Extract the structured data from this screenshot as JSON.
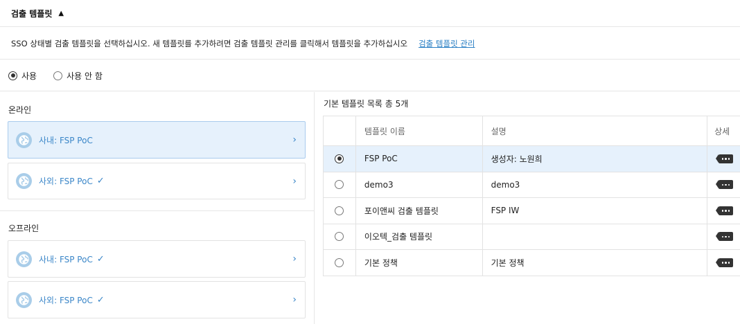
{
  "header": {
    "title": "검출 템플릿",
    "caret": "▲"
  },
  "description": {
    "text": "SSO 상태별 검출 템플릿을 선택하십시오. 새 템플릿를 추가하려면 검출 템플릿 관리를 클릭해서 템플릿을 추가하십시오",
    "link": "검출 템플릿 관리"
  },
  "usage": {
    "options": [
      {
        "label": "사용",
        "selected": true
      },
      {
        "label": "사용 안 함",
        "selected": false
      }
    ]
  },
  "left": {
    "online": {
      "label": "온라인",
      "cards": [
        {
          "label": "사내: FSP PoC",
          "checked": false,
          "selected": true
        },
        {
          "label": "사외: FSP PoC",
          "checked": true,
          "selected": false
        }
      ]
    },
    "offline": {
      "label": "오프라인",
      "cards": [
        {
          "label": "사내: FSP PoC",
          "checked": true,
          "selected": false
        },
        {
          "label": "사외: FSP PoC",
          "checked": true,
          "selected": false
        }
      ]
    },
    "check_glyph": "✓",
    "chevron_glyph": "›"
  },
  "table": {
    "title": "기본 템플릿 목록 총 5개",
    "columns": [
      "",
      "템플릿 이름",
      "설명",
      "상세"
    ],
    "rows": [
      {
        "name": "FSP PoC",
        "desc": "생성자: 노원희",
        "selected": true
      },
      {
        "name": "demo3",
        "desc": "demo3",
        "selected": false
      },
      {
        "name": "포이앤씨 검출 템플릿",
        "desc": "FSP IW",
        "selected": false
      },
      {
        "name": "이오텍_검출 템플릿",
        "desc": "",
        "selected": false
      },
      {
        "name": "기본 정책",
        "desc": "기본 정책",
        "selected": false
      }
    ]
  },
  "icons": {
    "globe": "globe-icon",
    "more": "more-icon"
  }
}
